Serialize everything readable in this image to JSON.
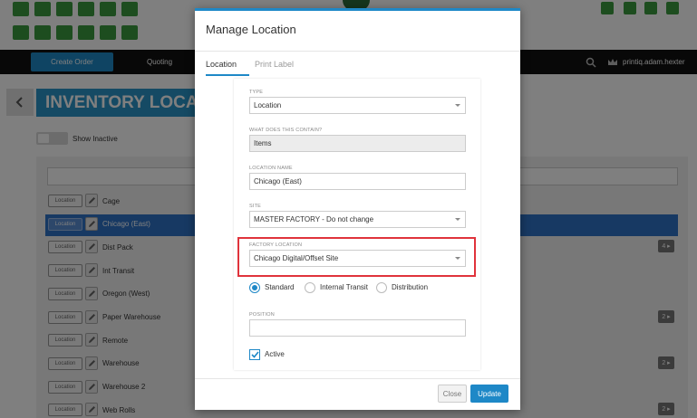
{
  "navbar": {
    "create_order": "Create Order",
    "quoting": "Quoting",
    "username": "printiq.adam.hexter"
  },
  "page": {
    "title": "INVENTORY LOCA",
    "show_inactive": "Show Inactive"
  },
  "locations": [
    {
      "tag": "Location",
      "name": "Cage",
      "badge": ""
    },
    {
      "tag": "Location",
      "name": "Chicago (East)",
      "badge": "",
      "selected": true
    },
    {
      "tag": "Location",
      "name": "Dist Pack",
      "badge": "4"
    },
    {
      "tag": "Location",
      "name": "Int Transit",
      "badge": ""
    },
    {
      "tag": "Location",
      "name": "Oregon (West)",
      "badge": ""
    },
    {
      "tag": "Location",
      "name": "Paper Warehouse",
      "badge": "2"
    },
    {
      "tag": "Location",
      "name": "Remote",
      "badge": ""
    },
    {
      "tag": "Location",
      "name": "Warehouse",
      "badge": "2"
    },
    {
      "tag": "Location",
      "name": "Warehouse 2",
      "badge": ""
    },
    {
      "tag": "Location",
      "name": "Web Rolls",
      "badge": "2"
    }
  ],
  "modal": {
    "title": "Manage Location",
    "tabs": {
      "location": "Location",
      "print_label": "Print Label"
    },
    "type": {
      "label": "TYPE",
      "value": "Location"
    },
    "contains": {
      "label": "WHAT DOES THIS CONTAIN?",
      "value": "Items"
    },
    "location_name": {
      "label": "LOCATION NAME",
      "value": "Chicago (East)"
    },
    "site": {
      "label": "SITE",
      "value": "MASTER FACTORY - Do not change"
    },
    "factory_location": {
      "label": "FACTORY LOCATION",
      "value": "Chicago Digital/Offset Site"
    },
    "radios": {
      "standard": "Standard",
      "internal_transit": "Internal Transit",
      "distribution": "Distribution",
      "selected": "Standard"
    },
    "position": {
      "label": "POSITION",
      "value": ""
    },
    "active": {
      "label": "Active",
      "checked": true
    },
    "buttons": {
      "close": "Close",
      "update": "Update"
    }
  },
  "colors": {
    "accent": "#1e88c7",
    "highlight": "#e0333c",
    "brand_green": "#3a9a3e",
    "selected_row": "#2e73c7"
  }
}
